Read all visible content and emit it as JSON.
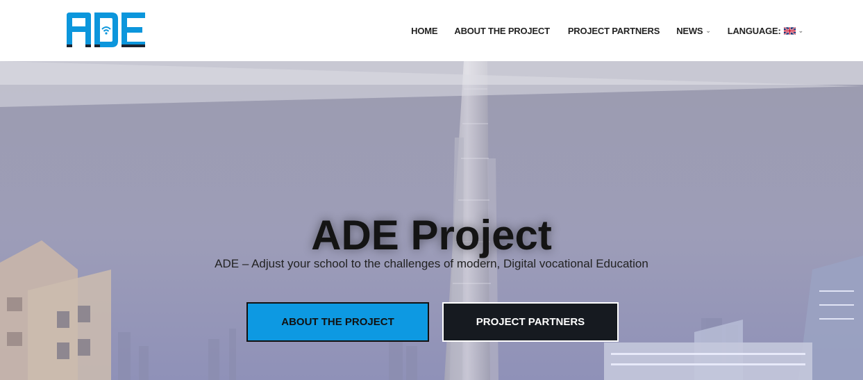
{
  "brand": {
    "logo_text": "ADE",
    "logo_color": "#0c96dc"
  },
  "nav": {
    "items": [
      {
        "label": "HOME"
      },
      {
        "label": "ABOUT THE PROJECT"
      },
      {
        "label": "PROJECT PARTNERS"
      },
      {
        "label": "NEWS",
        "has_dropdown": true
      },
      {
        "label": "LANGUAGE:",
        "has_dropdown": true,
        "icon": "uk-flag-icon"
      }
    ]
  },
  "hero": {
    "title": "ADE Project",
    "subtitle": "ADE – Adjust your school to the challenges of modern, Digital vocational Education",
    "buttons": {
      "about": {
        "label": "ABOUT THE PROJECT",
        "color": "#0d99e2"
      },
      "partners": {
        "label": "PROJECT PARTNERS",
        "color": "#161a20"
      }
    }
  }
}
